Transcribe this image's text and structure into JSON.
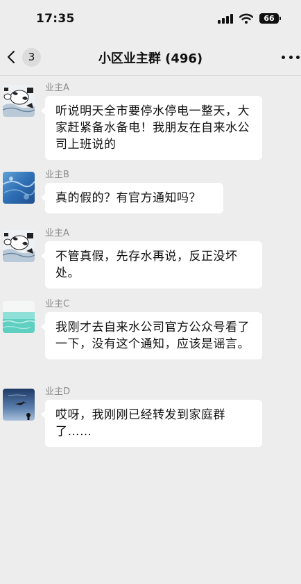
{
  "status_bar": {
    "time": "17:35",
    "battery": "66"
  },
  "header": {
    "unread_count": "3",
    "title": "小区业主群 (496)",
    "back_icon": "chevron-left-icon",
    "more_icon": "ellipsis-icon"
  },
  "messages": [
    {
      "sender": "业主A",
      "text": "听说明天全市要停水停电一整天，大家赶紧备水备电！我朋友在自来水公司上班说的",
      "avatar": "avatar-cow"
    },
    {
      "sender": "业主B",
      "text": "真的假的？有官方通知吗？",
      "avatar": "avatar-ocean"
    },
    {
      "sender": "业主A",
      "text": "不管真假，先存水再说，反正没坏处。",
      "avatar": "avatar-cow"
    },
    {
      "sender": "业主C",
      "text": "我刚才去自来水公司官方公众号看了一下，没有这个通知，应该是谣言。",
      "avatar": "avatar-sea"
    },
    {
      "sender": "业主D",
      "text": "哎呀，我刚刚已经转发到家庭群了……",
      "avatar": "avatar-sky-plane"
    }
  ],
  "colors": {
    "background": "#ededed",
    "bubble": "#ffffff",
    "sender_name": "#8a8a8a"
  }
}
